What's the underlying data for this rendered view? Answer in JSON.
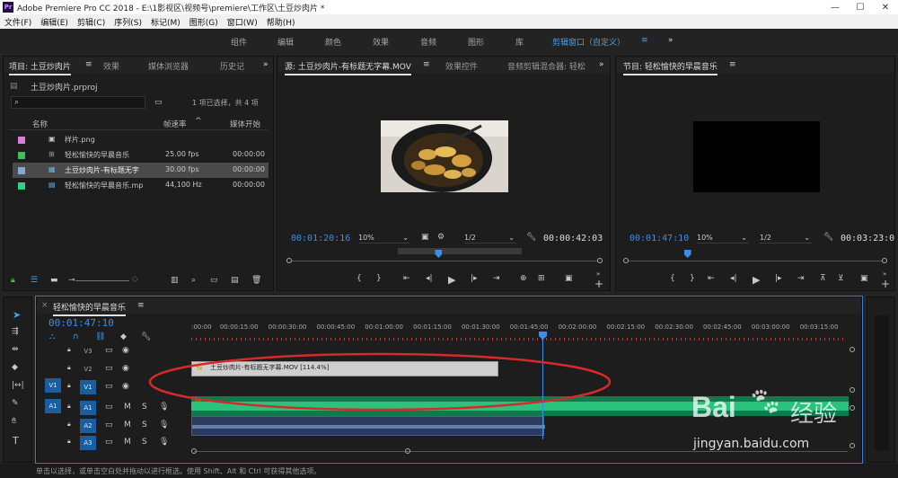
{
  "window": {
    "title": "Adobe Premiere Pro CC 2018 - E:\\1影视区\\视频号\\premiere\\工作区\\土豆炒肉片 *",
    "app_icon": "Pr",
    "minimize_icon": "minimize-icon",
    "maximize_icon": "maximize-icon",
    "close_icon": "close-icon"
  },
  "menu": [
    "文件(F)",
    "编辑(E)",
    "剪辑(C)",
    "序列(S)",
    "标记(M)",
    "图形(G)",
    "窗口(W)",
    "帮助(H)"
  ],
  "workspaces": {
    "items": [
      "组件",
      "编辑",
      "颜色",
      "效果",
      "音频",
      "图形",
      "库"
    ],
    "active": "剪辑窗口（自定义）",
    "menu_glyph": "≡",
    "more": "»"
  },
  "project_panel": {
    "tabs": [
      "项目: 土豆炒肉片",
      "效果",
      "媒体浏览器",
      "历史记"
    ],
    "tab_menu": "≡",
    "more": "»",
    "file_name": "土豆炒肉片.prproj",
    "search_placeholder": "",
    "selection_info": "1 项已选择，共 4 项",
    "columns": {
      "name": "名称",
      "fps": "帧速率",
      "start": "媒体开始"
    },
    "rows": [
      {
        "name": "样片.png",
        "fps": "",
        "start": "",
        "color": "#d97bd9",
        "icon": "image-file-icon"
      },
      {
        "name": "轻松愉快的早晨音乐",
        "fps": "25.00 fps",
        "start": "00:00:00",
        "color": "#3fbf5a",
        "icon": "sequence-icon"
      },
      {
        "name": "土豆炒肉片-有标题无字",
        "fps": "30.00 fps",
        "start": "00:00:00",
        "color": "#8aa6d6",
        "icon": "video-file-icon"
      },
      {
        "name": "轻松愉快的早晨音乐.mp",
        "fps": "44,100 Hz",
        "start": "00:00:00",
        "color": "#2fcf86",
        "icon": "audio-file-icon"
      }
    ]
  },
  "source_monitor": {
    "tabs": [
      "源: 土豆炒肉片-有标题无字幕.MOV",
      "效果控件",
      "音频剪辑混合器: 轻松"
    ],
    "tab_menu": "≡",
    "more": "»",
    "timecode_current": "00:01:20:16",
    "zoom": "10%",
    "resolution": "1/2",
    "timecode_duration": "00:00:42:03",
    "playhead_fraction": 0.47
  },
  "program_monitor": {
    "title": "节目: 轻松愉快的早晨音乐",
    "tab_menu": "≡",
    "timecode_current": "00:01:47:10",
    "zoom": "10%",
    "resolution": "1/2",
    "timecode_duration": "00:03:23:0",
    "playhead_fraction": 0.23
  },
  "timeline": {
    "sequence_name": "轻松愉快的早晨音乐",
    "tab_menu": "≡",
    "timecode": "00:01:47:10",
    "ruler_labels": [
      ":00:00",
      "00:00:15:00",
      "00:00:30:00",
      "00:00:45:00",
      "00:01:00:00",
      "00:01:15:00",
      "00:01:30:00",
      "00:01:45:00",
      "00:02:00:00",
      "00:02:15:00",
      "00:02:30:00",
      "00:02:45:00",
      "00:03:00:00",
      "00:03:15:00"
    ],
    "playhead_time": "00:01:47:10",
    "tracks": [
      "V3",
      "V2",
      "V1",
      "A1",
      "A2",
      "A3"
    ],
    "source_patch": {
      "video": "V1",
      "audio": "A1"
    },
    "track_buttons": {
      "mute": "M",
      "solo": "S"
    },
    "clip_label": "土豆炒肉片-有标题无字幕.MOV [114.4%]",
    "clip_fx": "fx",
    "audio_fx": "fx"
  },
  "tools": [
    "selection-tool-icon",
    "track-select-tool-icon",
    "ripple-edit-tool-icon",
    "razor-tool-icon",
    "slip-tool-icon",
    "pen-tool-icon",
    "hand-tool-icon",
    "type-tool-icon"
  ],
  "status_bar": "单击以选择，或单击空白处并拖动以进行框选。使用 Shift、Alt 和 Ctrl 可获得其他选项。",
  "watermark": {
    "brand": "Bai",
    "brand2": "经验",
    "url": "jingyan.baidu.com"
  },
  "colors": {
    "accent": "#3b8fe8",
    "audio_track": "#22a86b",
    "annotation": "#d62a2a",
    "clip": "#cfcfcf"
  }
}
